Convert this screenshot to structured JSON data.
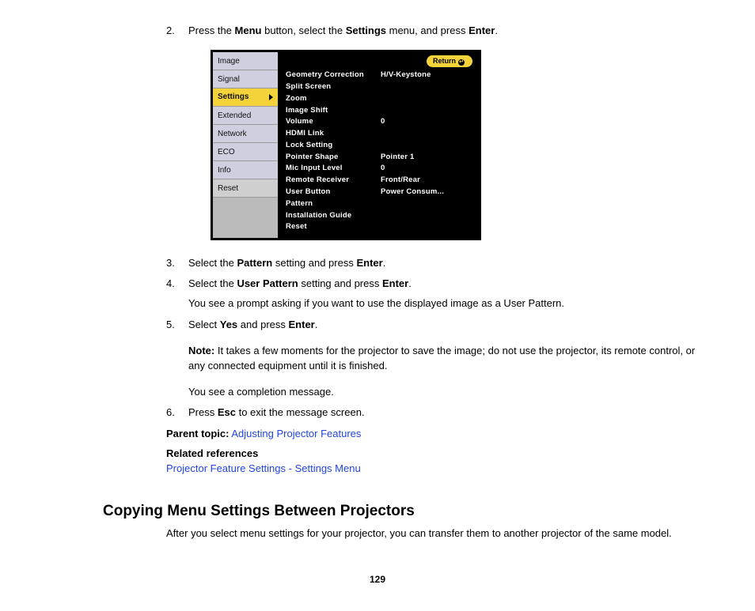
{
  "steps": {
    "s2": {
      "num": "2.",
      "pre": "Press the ",
      "b1": "Menu",
      "mid1": " button, select the ",
      "b2": "Settings",
      "mid2": " menu, and press ",
      "b3": "Enter",
      "post": "."
    },
    "s3": {
      "num": "3.",
      "pre": "Select the ",
      "b1": "Pattern",
      "mid1": " setting and press ",
      "b2": "Enter",
      "post": "."
    },
    "s4": {
      "num": "4.",
      "pre": "Select the ",
      "b1": "User Pattern",
      "mid1": " setting and press ",
      "b2": "Enter",
      "post": ".",
      "sub": "You see a prompt asking if you want to use the displayed image as a User Pattern."
    },
    "s5": {
      "num": "5.",
      "pre": "Select ",
      "b1": "Yes",
      "mid1": " and press ",
      "b2": "Enter",
      "post": ".",
      "noteLabel": "Note:",
      "note": " It takes a few moments for the projector to save the image; do not use the projector, its remote control, or any connected equipment until it is finished.",
      "sub2": "You see a completion message."
    },
    "s6": {
      "num": "6.",
      "pre": "Press ",
      "b1": "Esc",
      "post": " to exit the message screen."
    }
  },
  "parent": {
    "label": "Parent topic:",
    "link": "Adjusting Projector Features"
  },
  "related": {
    "label": "Related references",
    "link": "Projector Feature Settings - Settings Menu"
  },
  "section": {
    "title": "Copying Menu Settings Between Projectors",
    "body": "After you select menu settings for your projector, you can transfer them to another projector of the same model."
  },
  "pageNumber": "129",
  "osd": {
    "return": "Return",
    "tabs": [
      "Image",
      "Signal",
      "Settings",
      "Extended",
      "Network",
      "ECO",
      "Info",
      "Reset"
    ],
    "rows": [
      {
        "lbl": "Geometry Correction",
        "val": "H/V-Keystone"
      },
      {
        "lbl": "Split Screen",
        "val": ""
      },
      {
        "lbl": "Zoom",
        "val": ""
      },
      {
        "lbl": "Image Shift",
        "val": ""
      },
      {
        "lbl": "Volume",
        "val": "0"
      },
      {
        "lbl": "HDMI Link",
        "val": ""
      },
      {
        "lbl": "Lock Setting",
        "val": ""
      },
      {
        "lbl": "Pointer Shape",
        "val": "Pointer 1"
      },
      {
        "lbl": "Mic Input Level",
        "val": "0"
      },
      {
        "lbl": "Remote Receiver",
        "val": "Front/Rear"
      },
      {
        "lbl": "User Button",
        "val": "Power Consum..."
      },
      {
        "lbl": "Pattern",
        "val": ""
      },
      {
        "lbl": "Installation Guide",
        "val": ""
      },
      {
        "lbl": "Reset",
        "val": ""
      }
    ]
  }
}
